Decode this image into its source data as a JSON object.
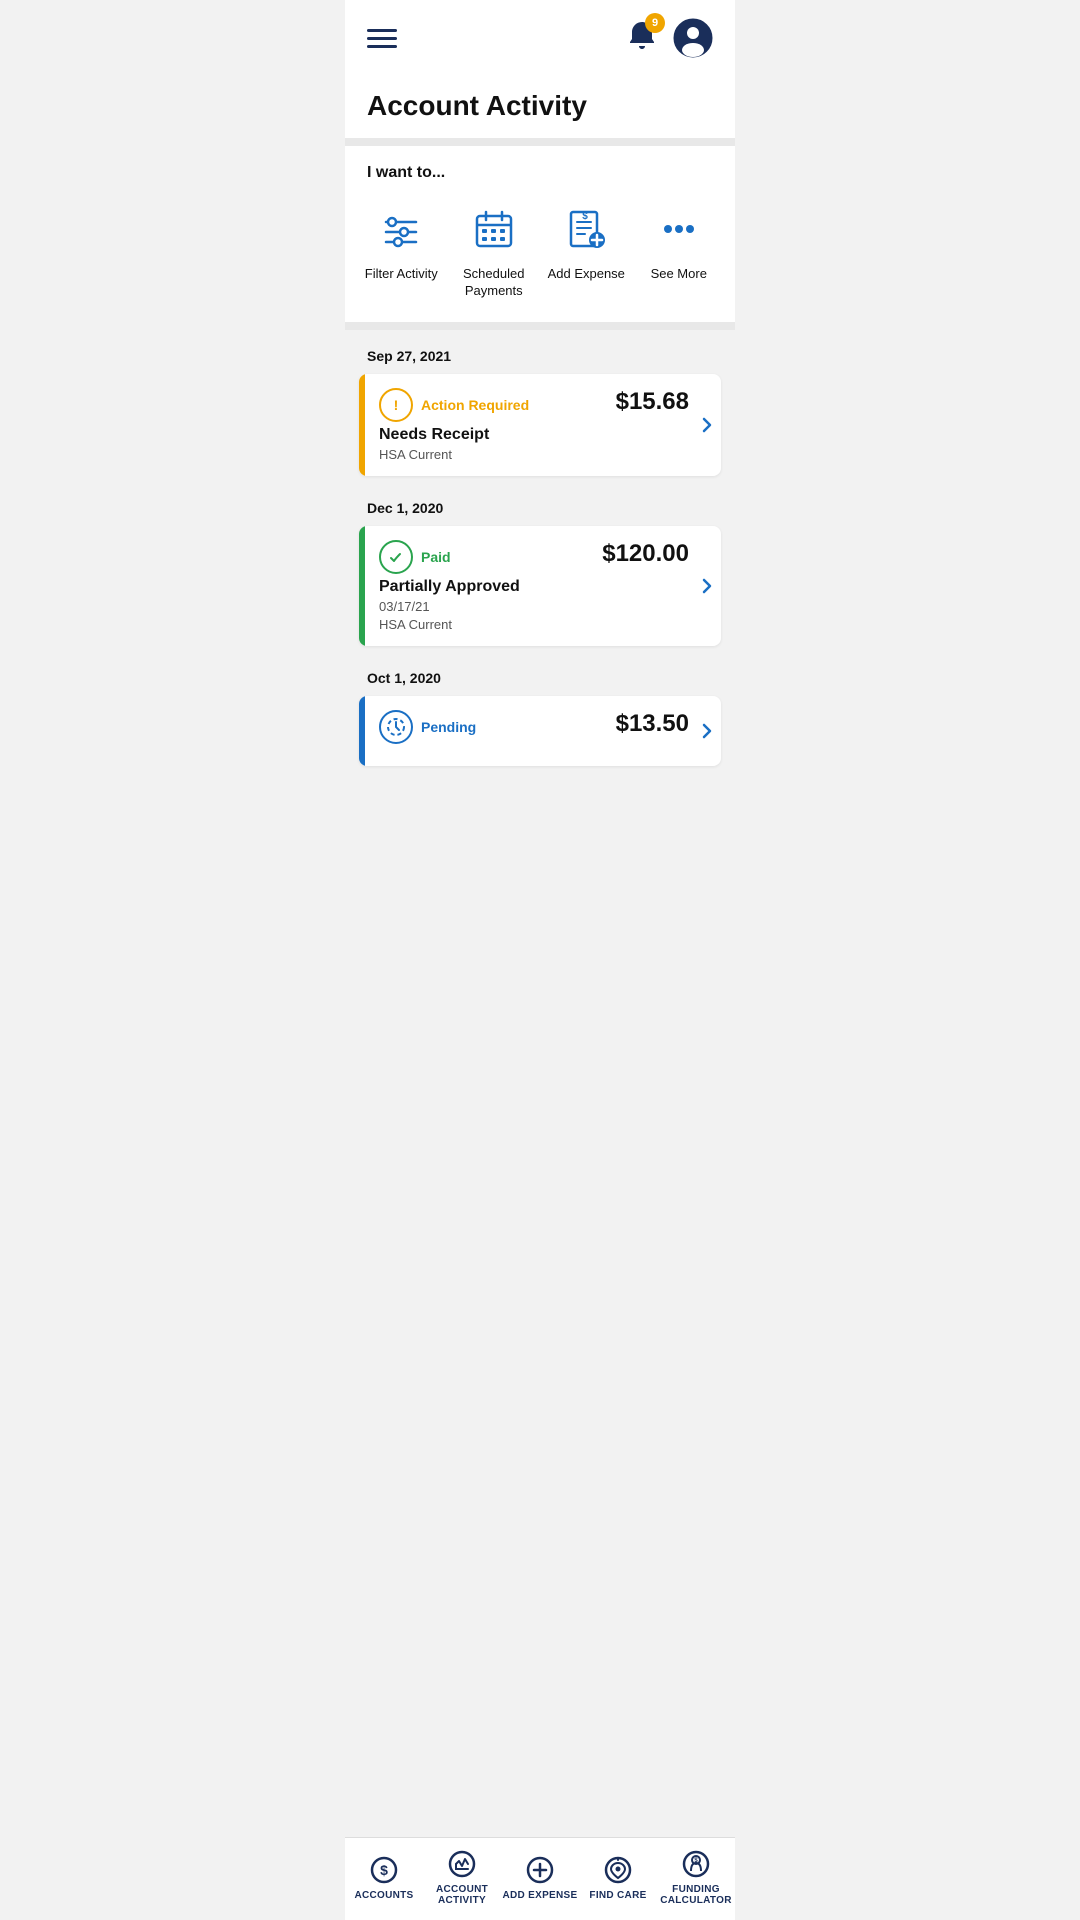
{
  "header": {
    "bell_count": "9",
    "hamburger_label": "Menu"
  },
  "page": {
    "title": "Account Activity"
  },
  "i_want": {
    "label": "I want to...",
    "actions": [
      {
        "id": "filter",
        "label": "Filter Activity"
      },
      {
        "id": "scheduled",
        "label": "Scheduled Payments"
      },
      {
        "id": "add-expense",
        "label": "Add Expense"
      },
      {
        "id": "see-more",
        "label": "See More"
      }
    ]
  },
  "activity": [
    {
      "date": "Sep 27, 2021",
      "border_color": "orange",
      "status": "Action Required",
      "status_color": "#f0a500",
      "description": "Needs Receipt",
      "sub1": "HSA Current",
      "sub2": "",
      "amount": "$15.68"
    },
    {
      "date": "Dec 1, 2020",
      "border_color": "green",
      "status": "Paid",
      "status_color": "#2aa44e",
      "description": "Partially Approved",
      "sub1": "03/17/21",
      "sub2": "HSA Current",
      "amount": "$120.00"
    },
    {
      "date": "Oct 1, 2020",
      "border_color": "blue",
      "status": "Pending",
      "status_color": "#1a6fc4",
      "description": "",
      "sub1": "",
      "sub2": "",
      "amount": "$13.50"
    }
  ],
  "bottom_nav": [
    {
      "id": "accounts",
      "label": "ACCOUNTS"
    },
    {
      "id": "account-activity",
      "label": "ACCOUNT ACTIVITY"
    },
    {
      "id": "add-expense",
      "label": "ADD EXPENSE"
    },
    {
      "id": "find-care",
      "label": "FIND CARE"
    },
    {
      "id": "funding-calculator",
      "label": "FUNDING CALCULATOR"
    }
  ]
}
